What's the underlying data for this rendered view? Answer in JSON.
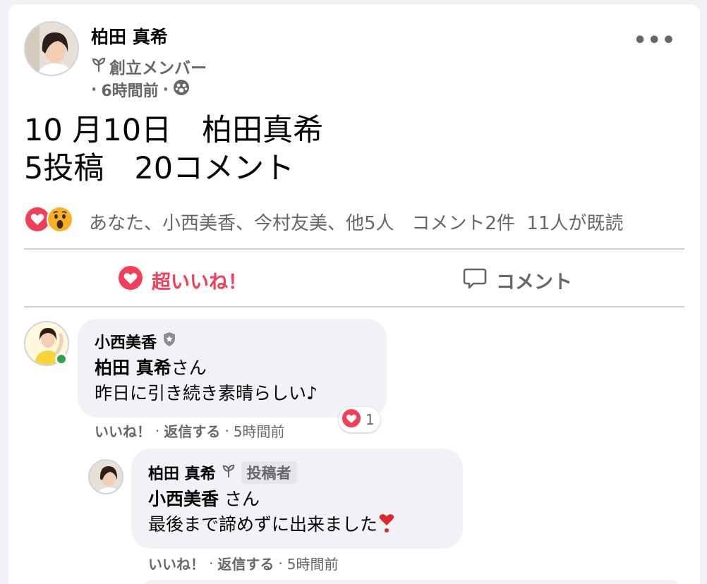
{
  "post": {
    "author": "柏田 真希",
    "badge": "創立メンバー",
    "time": "6時間前",
    "body_line1": "10 月10日　柏田真希",
    "body_line2": "5投稿　20コメント"
  },
  "reactions": {
    "summary": "あなた、小西美香、今村友美、他5人",
    "comments_count": "コメント2件",
    "seen_count": "11人が既読"
  },
  "actions": {
    "love_label": "超いいね！",
    "comment_label": "コメント"
  },
  "comments": [
    {
      "author": "小西美香",
      "mention": "柏田 真希",
      "mention_suffix": "さん",
      "text": "昨日に引き続き素晴らしい♪",
      "like_label": "いいね！",
      "reply_label": "返信する",
      "time": "5時間前",
      "reaction_count": "1"
    },
    {
      "author": "柏田 真希",
      "author_tag": "投稿者",
      "mention": "小西美香",
      "mention_suffix": "さん",
      "text": "最後まで諦めずに出来ました",
      "like_label": "いいね！",
      "reply_label": "返信する",
      "time": "5時間前"
    }
  ],
  "colors": {
    "love": "#f33e58",
    "muted": "#65676b",
    "bubble": "#f0f2f5",
    "online": "#31a24c"
  },
  "icons": [
    "sprout-icon",
    "group-icon",
    "more-icon",
    "love-reaction-icon",
    "wow-reaction-icon",
    "comment-icon",
    "admin-shield-icon",
    "red-heart-emoji-icon"
  ]
}
